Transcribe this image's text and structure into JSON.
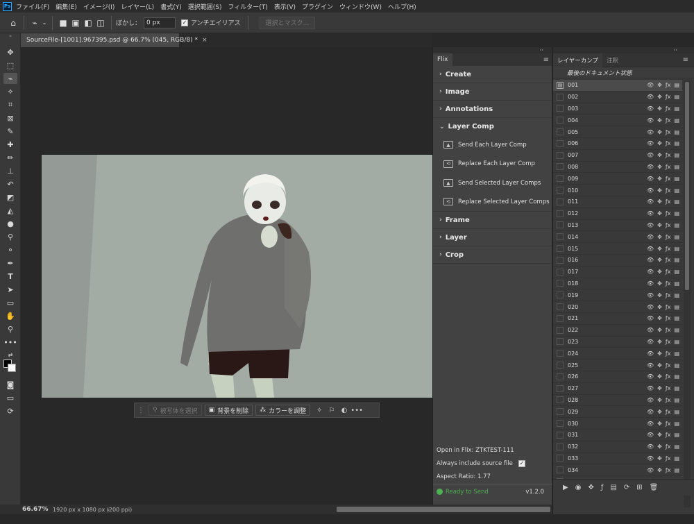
{
  "app": {
    "logo": "Ps"
  },
  "menu": [
    "ファイル(F)",
    "編集(E)",
    "イメージ(I)",
    "レイヤー(L)",
    "書式(Y)",
    "選択範囲(S)",
    "フィルター(T)",
    "表示(V)",
    "プラグイン",
    "ウィンドウ(W)",
    "ヘルプ(H)"
  ],
  "options": {
    "feather_label": "ぼかし：",
    "feather_value": "0 px",
    "antialias_label": "アンチエイリアス",
    "antialias_checked": true,
    "select_mask_label": "選択とマスク..."
  },
  "document": {
    "tab_title": "SourceFile-[1001].967395.psd @ 66.7% (045, RGB/8) *",
    "close": "×"
  },
  "taskbar": {
    "select_subject": "被写体を選択",
    "remove_bg": "背景を削除",
    "adjust_color": "カラーを調整",
    "more": "•••"
  },
  "status": {
    "zoom": "66.67%",
    "doc_size": "1920 px x 1080 px (200 ppi)"
  },
  "flix": {
    "collapse": "‹‹",
    "close": "×",
    "tab": "Flix",
    "sections_top": [
      "Create",
      "Image",
      "Annotations"
    ],
    "layer_comp": "Layer Comp",
    "actions": [
      "Send Each Layer Comp",
      "Replace Each Layer Comp",
      "Send Selected Layer Comps",
      "Replace Selected Layer Comps"
    ],
    "sections_bottom": [
      "Frame",
      "Layer",
      "Crop"
    ],
    "open_in": "Open in Flix: ZTKTEST-111",
    "always_include": "Always include source file",
    "always_include_checked": true,
    "aspect_ratio": "Aspect Ratio: 1.77",
    "ready": "Ready to Send",
    "version": "v1.2.0"
  },
  "layer_comps": {
    "collapse": "‹‹",
    "close": "×",
    "tabs": [
      "レイヤーカンプ",
      "注釈"
    ],
    "last_state": "最後のドキュメント状態",
    "items": [
      "001",
      "002",
      "003",
      "004",
      "005",
      "006",
      "007",
      "008",
      "009",
      "010",
      "011",
      "012",
      "013",
      "014",
      "015",
      "016",
      "017",
      "018",
      "019",
      "020",
      "021",
      "022",
      "023",
      "024",
      "025",
      "026",
      "027",
      "028",
      "029",
      "030",
      "031",
      "032",
      "033",
      "034",
      "035"
    ],
    "selected": "001"
  }
}
